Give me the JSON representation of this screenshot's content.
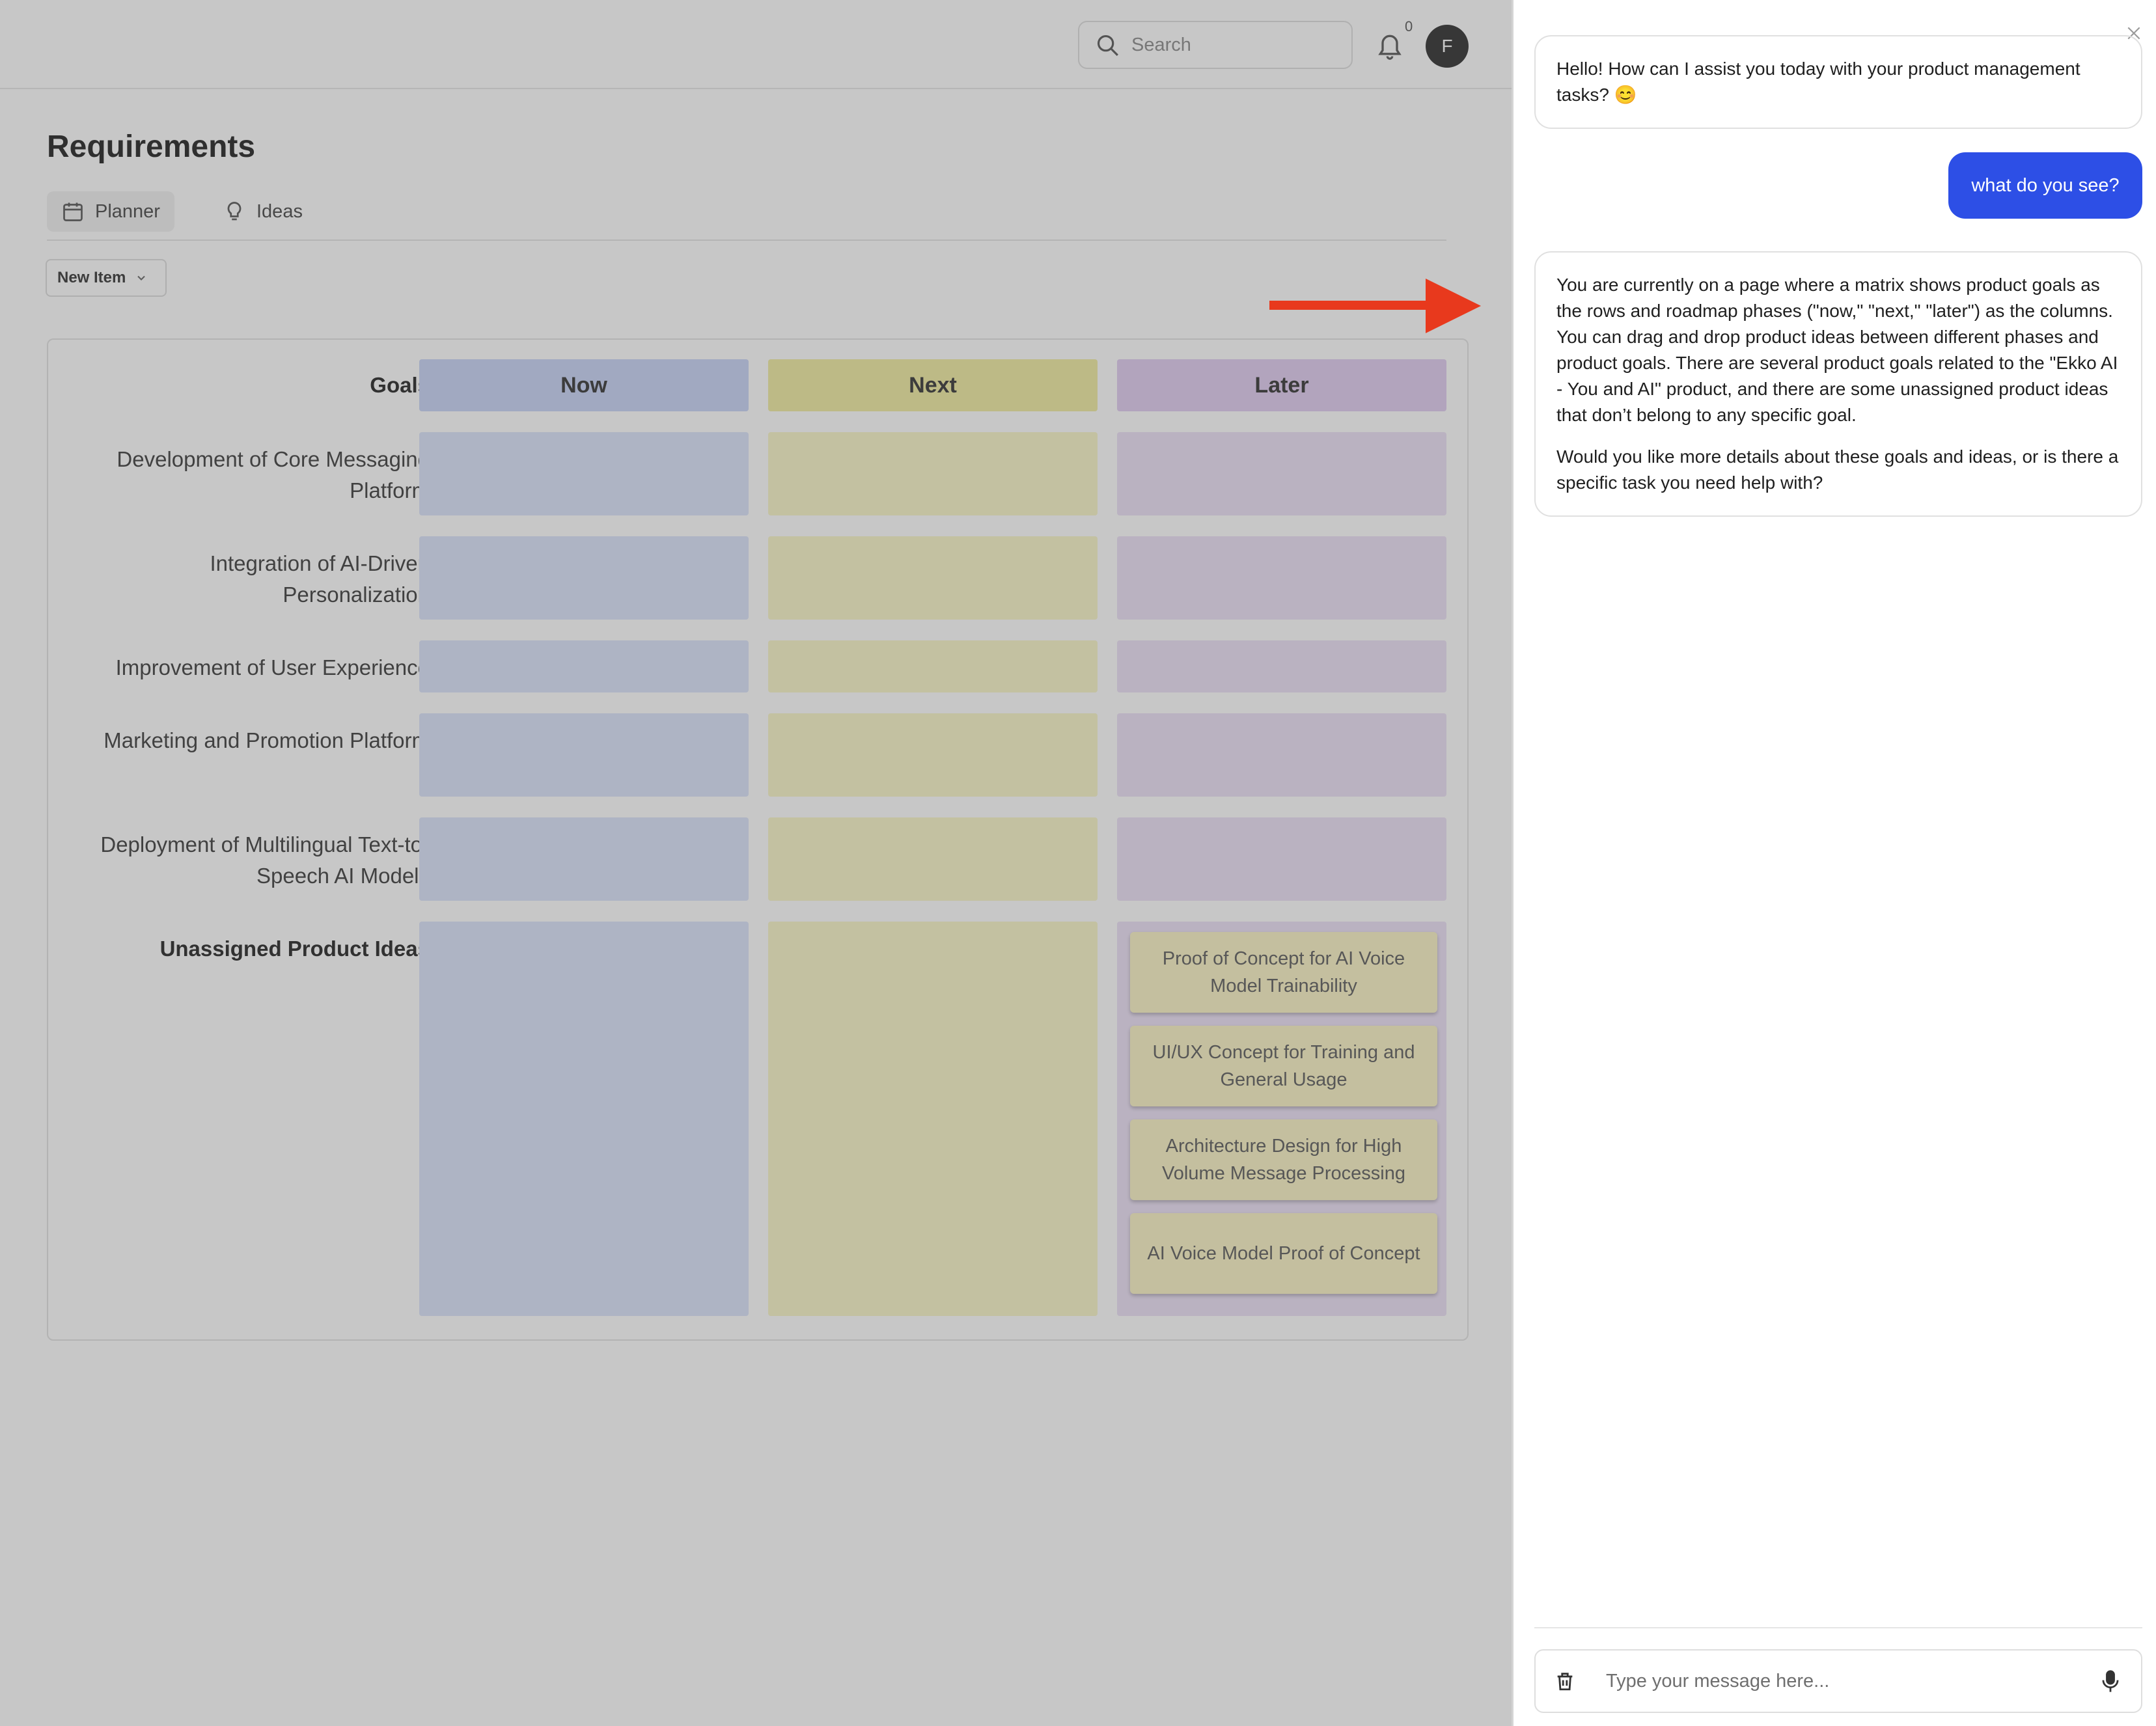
{
  "header": {
    "search_placeholder": "Search",
    "notification_count": "0",
    "avatar_initial": "F"
  },
  "page": {
    "title": "Requirements",
    "tabs": [
      {
        "label": "Planner",
        "icon": "calendar-icon",
        "active": true
      },
      {
        "label": "Ideas",
        "icon": "lightbulb-icon",
        "active": false
      }
    ],
    "new_item_label": "New Item"
  },
  "board": {
    "goals_header": "Goals",
    "columns": [
      "Now",
      "Next",
      "Later"
    ],
    "goals": [
      "Development of Core Messaging Platform",
      "Integration of AI-Driven Personalization",
      "Improvement of User Experience",
      "Marketing and Promotion Platform",
      "Deployment of Multilingual Text-to-Speech AI Models"
    ],
    "unassigned_label": "Unassigned Product Ideas",
    "unassigned_later_ideas": [
      "Proof of Concept for AI Voice Model Trainability",
      "UI/UX Concept for Training and General Usage",
      "Architecture Design for High Volume Message Processing",
      "AI Voice Model Proof of Concept"
    ]
  },
  "chat": {
    "messages": [
      {
        "role": "assistant",
        "paragraphs": [
          "Hello! How can I assist you today with your product management tasks? 😊"
        ]
      },
      {
        "role": "user",
        "text": "what do you see?"
      },
      {
        "role": "assistant",
        "paragraphs": [
          "You are currently on a page where a matrix shows product goals as the rows and roadmap phases (\"now,\" \"next,\" \"later\") as the columns. You can drag and drop product ideas between different phases and product goals. There are several product goals related to the \"Ekko AI - You and AI\" product, and there are some unassigned product ideas that don’t belong to any specific goal.",
          "Would you like more details about these goals and ideas, or is there a specific task you need help with?"
        ]
      }
    ],
    "input_placeholder": "Type your message here..."
  },
  "colors": {
    "user_bubble": "#2d4fe6",
    "annotation_arrow": "#e8391d",
    "now_column": "#dbe3fb",
    "next_column": "#f9f6c8",
    "later_column": "#ece1f6"
  }
}
